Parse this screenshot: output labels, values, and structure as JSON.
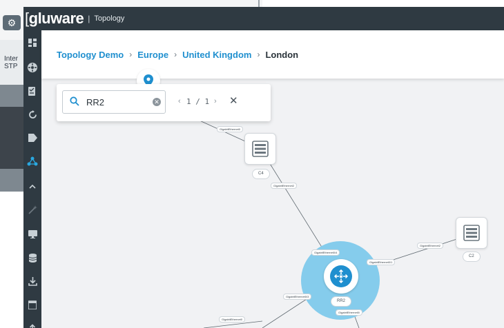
{
  "background_window": {
    "text_lines": [
      "Inter",
      "STP"
    ]
  },
  "app": {
    "logo": "gluware",
    "logo_bracket": "[",
    "title_separator": "|",
    "title": "Topology"
  },
  "sidebar": {
    "icons": [
      "dashboard-icon",
      "network-icon",
      "checklist-icon",
      "sync-icon",
      "tag-icon",
      "topology-icon",
      "collapse-icon",
      "wand-icon",
      "monitor-icon",
      "database-icon",
      "download-icon",
      "calendar-icon",
      "upload-icon"
    ],
    "active_index": 5
  },
  "breadcrumb": {
    "items": [
      "Topology Demo",
      "Europe",
      "United Kingdom",
      "London"
    ],
    "separator": "›"
  },
  "search": {
    "value": "RR2",
    "clear_glyph": "✕",
    "pager_prev": "‹",
    "pager_text": "1 / 1",
    "pager_next": "›",
    "close_glyph": "✕"
  },
  "nodes": {
    "c4": "C4",
    "c2": "C2",
    "rr2": "RR2"
  },
  "edge_labels": {
    "top_link": "GigabitEthernet0",
    "c4_link": "GigabitEthernet2",
    "rr2_up": "GigabitEthernet0/4",
    "c2_link": "GigabitEthernet2",
    "rr2_right": "GigabitEthernet0/1",
    "rr2_left": "GigabitEthernet0/3",
    "rr2_down": "GigabitEthernet0/",
    "bottom_link": "GigabitEthernet0"
  },
  "colors": {
    "accent": "#1f8fcf",
    "highlight": "#85ccec",
    "titlebar": "#2f3a42"
  }
}
